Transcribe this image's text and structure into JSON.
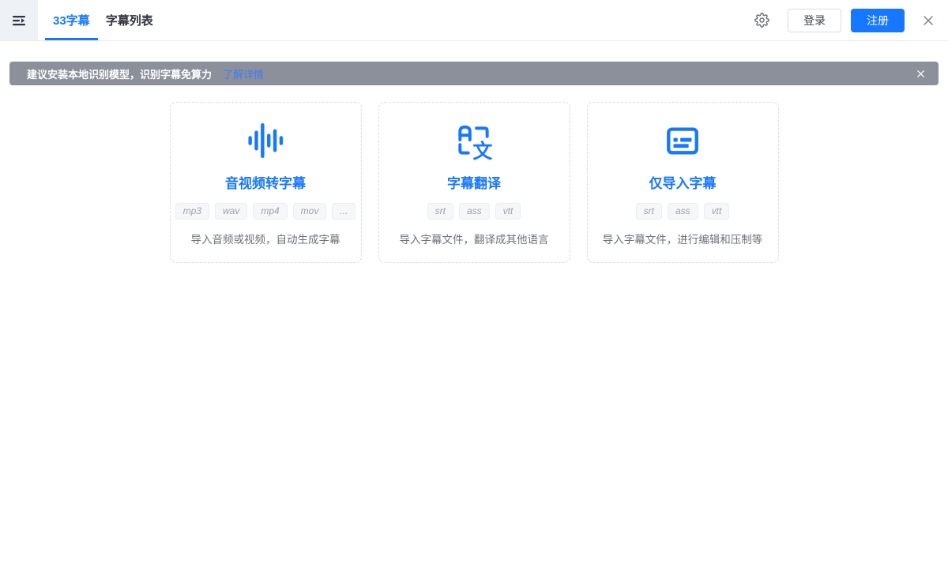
{
  "topbar": {
    "tabs": [
      {
        "label": "33字幕",
        "active": true
      },
      {
        "label": "字幕列表",
        "active": false
      }
    ],
    "login_label": "登录",
    "register_label": "注册"
  },
  "banner": {
    "message": "建议安装本地识别模型，识别字幕免算力",
    "link_label": "了解详情"
  },
  "cards": [
    {
      "icon": "waveform-icon",
      "title": "音视频转字幕",
      "tags": [
        "mp3",
        "wav",
        "mp4",
        "mov",
        "..."
      ],
      "description": "导入音频或视频，自动生成字幕"
    },
    {
      "icon": "translate-icon",
      "icon_glyph": "文",
      "title": "字幕翻译",
      "tags": [
        "srt",
        "ass",
        "vtt"
      ],
      "description": "导入字幕文件，翻译成其他语言"
    },
    {
      "icon": "subtitles-icon",
      "title": "仅导入字幕",
      "tags": [
        "srt",
        "ass",
        "vtt"
      ],
      "description": "导入字幕文件，进行编辑和压制等"
    }
  ],
  "colors": {
    "accent": "#1677ff",
    "banner_bg": "#8b909a",
    "link_blue": "#3f7df6"
  }
}
